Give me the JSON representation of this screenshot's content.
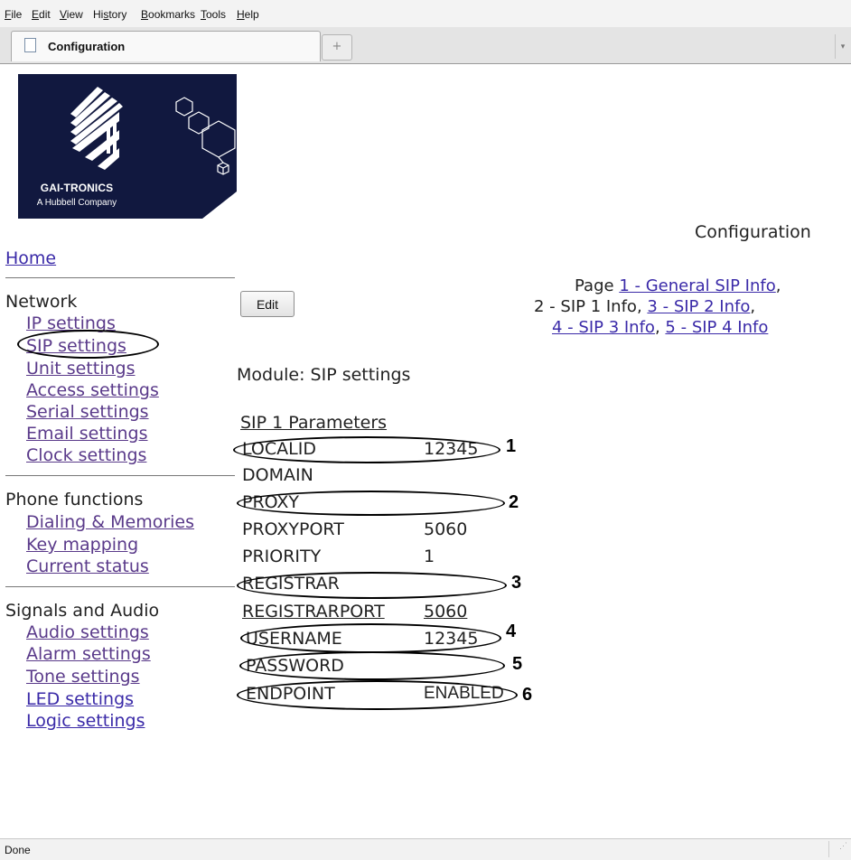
{
  "browser": {
    "menu": [
      "File",
      "Edit",
      "View",
      "History",
      "Bookmarks",
      "Tools",
      "Help"
    ],
    "tab_title": "Configuration",
    "new_tab_symbol": "+",
    "status": "Done"
  },
  "logo": {
    "brand": "GAI-TRONICS",
    "tagline": "A Hubbell Company"
  },
  "sidebar": {
    "home": "Home",
    "groups": [
      {
        "title": "Network",
        "items": [
          "IP settings",
          "SIP settings",
          "Unit settings",
          "Access settings",
          "Serial settings",
          "Email settings",
          "Clock settings"
        ]
      },
      {
        "title": "Phone functions",
        "items": [
          "Dialing & Memories",
          "Key mapping",
          "Current status"
        ]
      },
      {
        "title": "Signals and Audio",
        "items": [
          "Audio settings",
          "Alarm settings",
          "Tone settings",
          "LED settings",
          "Logic settings"
        ]
      }
    ]
  },
  "header": {
    "title": "Configuration",
    "page_prefix": "Page",
    "pages": [
      "1 - General SIP Info",
      "2 - SIP 1 Info",
      "3 - SIP 2 Info",
      "4 - SIP 3 Info",
      "5 - SIP 4 Info"
    ],
    "separator": ","
  },
  "main": {
    "edit_label": "Edit",
    "module_label": "Module: SIP settings",
    "section_title": "SIP 1 Parameters",
    "params": [
      {
        "name": "LOCALID",
        "value": "12345"
      },
      {
        "name": "DOMAIN",
        "value": ""
      },
      {
        "name": "PROXY",
        "value": ""
      },
      {
        "name": "PROXYPORT",
        "value": "5060"
      },
      {
        "name": "PRIORITY",
        "value": "1"
      },
      {
        "name": "REGISTRAR",
        "value": ""
      },
      {
        "name": "REGISTRARPORT",
        "value": "5060"
      },
      {
        "name": "USERNAME",
        "value": "12345"
      },
      {
        "name": "PASSWORD",
        "value": ""
      },
      {
        "name": "ENDPOINT",
        "value": "ENABLED"
      }
    ],
    "annotations": [
      "1",
      "2",
      "3",
      "4",
      "5",
      "6"
    ]
  }
}
